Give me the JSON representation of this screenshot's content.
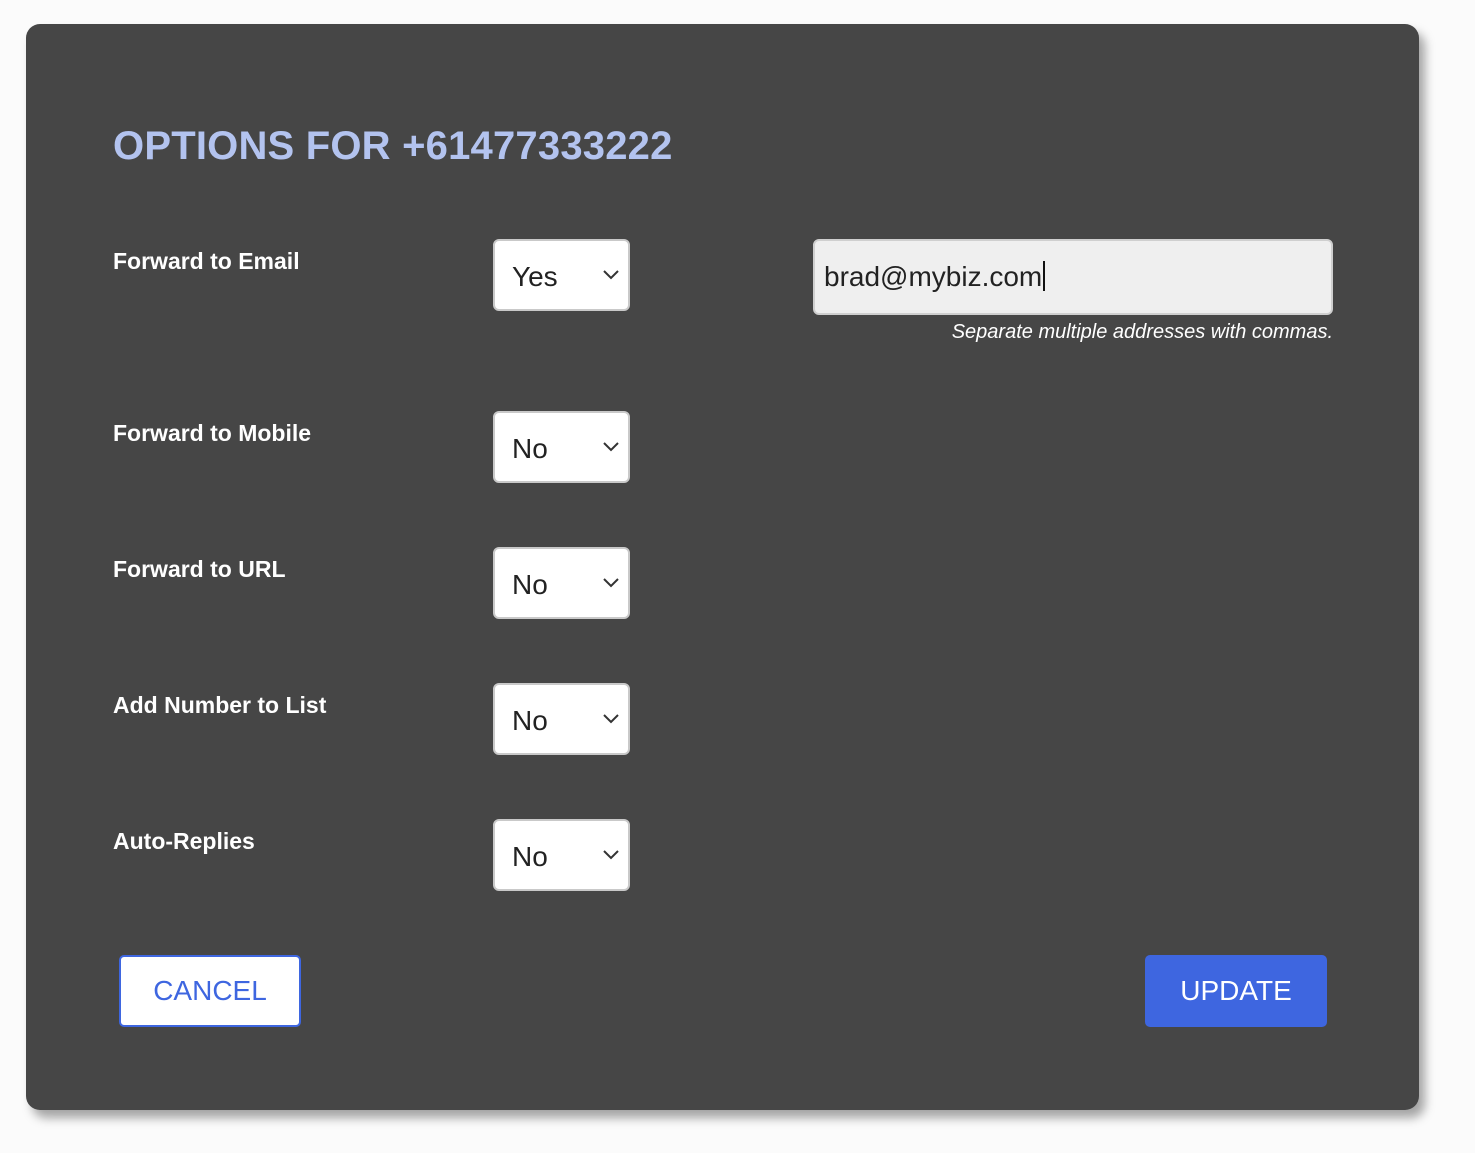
{
  "dialog": {
    "title": "OPTIONS FOR +61477333222",
    "accent_color": "#b3c3ef",
    "background_color": "#464646"
  },
  "rows": [
    {
      "label": "Forward to Email",
      "value": "Yes"
    },
    {
      "label": "Forward to Mobile",
      "value": "No"
    },
    {
      "label": "Forward to URL",
      "value": "No"
    },
    {
      "label": "Add Number to List",
      "value": "No"
    },
    {
      "label": "Auto-Replies",
      "value": "No"
    }
  ],
  "email": {
    "value": "brad@mybiz.com",
    "hint": "Separate multiple addresses with commas."
  },
  "buttons": {
    "cancel_label": "CANCEL",
    "update_label": "UPDATE",
    "primary_color": "#3e66e0"
  },
  "icons": {
    "select_arrow": "chevron-down-icon"
  }
}
